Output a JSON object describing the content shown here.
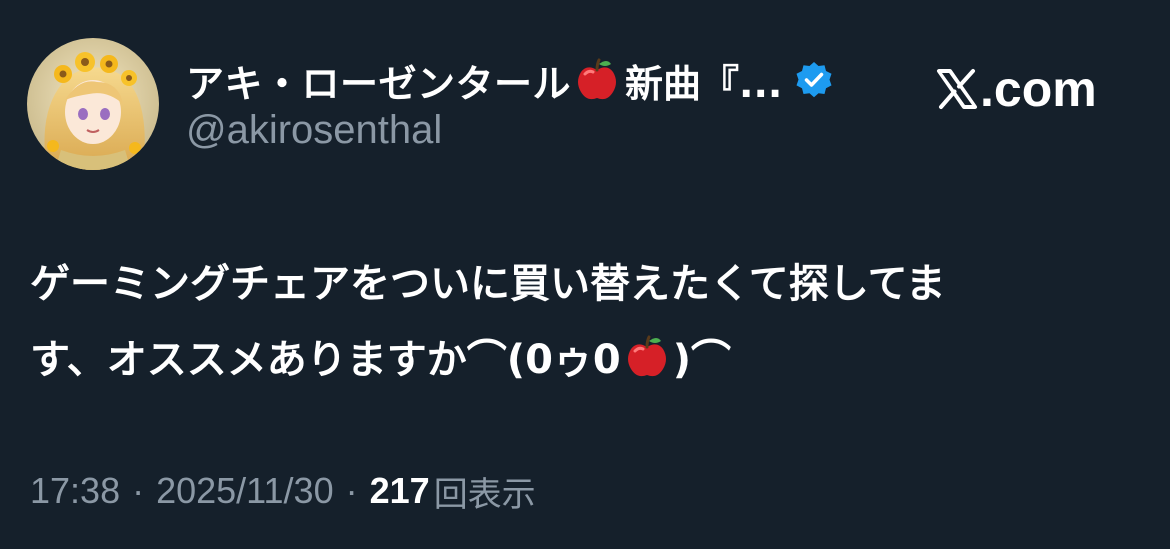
{
  "author": {
    "display_name": "アキ・ローゼンタール",
    "display_name_suffix": "新曲『...",
    "handle": "@akirosenthal",
    "verified": true,
    "name_emoji": "apple-icon"
  },
  "brand": {
    "site": ".com",
    "logo_icon": "x-logo-icon"
  },
  "tweet": {
    "line1": "ゲーミングチェアをついに買い替えたくて探してま",
    "line2_prefix": "す、オススメありますか⌒(0ゥ0",
    "line2_suffix": ")⌒",
    "inline_emoji": "apple-icon"
  },
  "meta": {
    "time": "17:38",
    "separator": "·",
    "date": "2025/11/30",
    "views_count": "217",
    "views_label": "回表示"
  },
  "colors": {
    "background": "#15202b",
    "primary_text": "#ffffff",
    "secondary_text": "#8b98a5",
    "verified_blue": "#1d9bf0",
    "apple_red": "#d62027"
  }
}
